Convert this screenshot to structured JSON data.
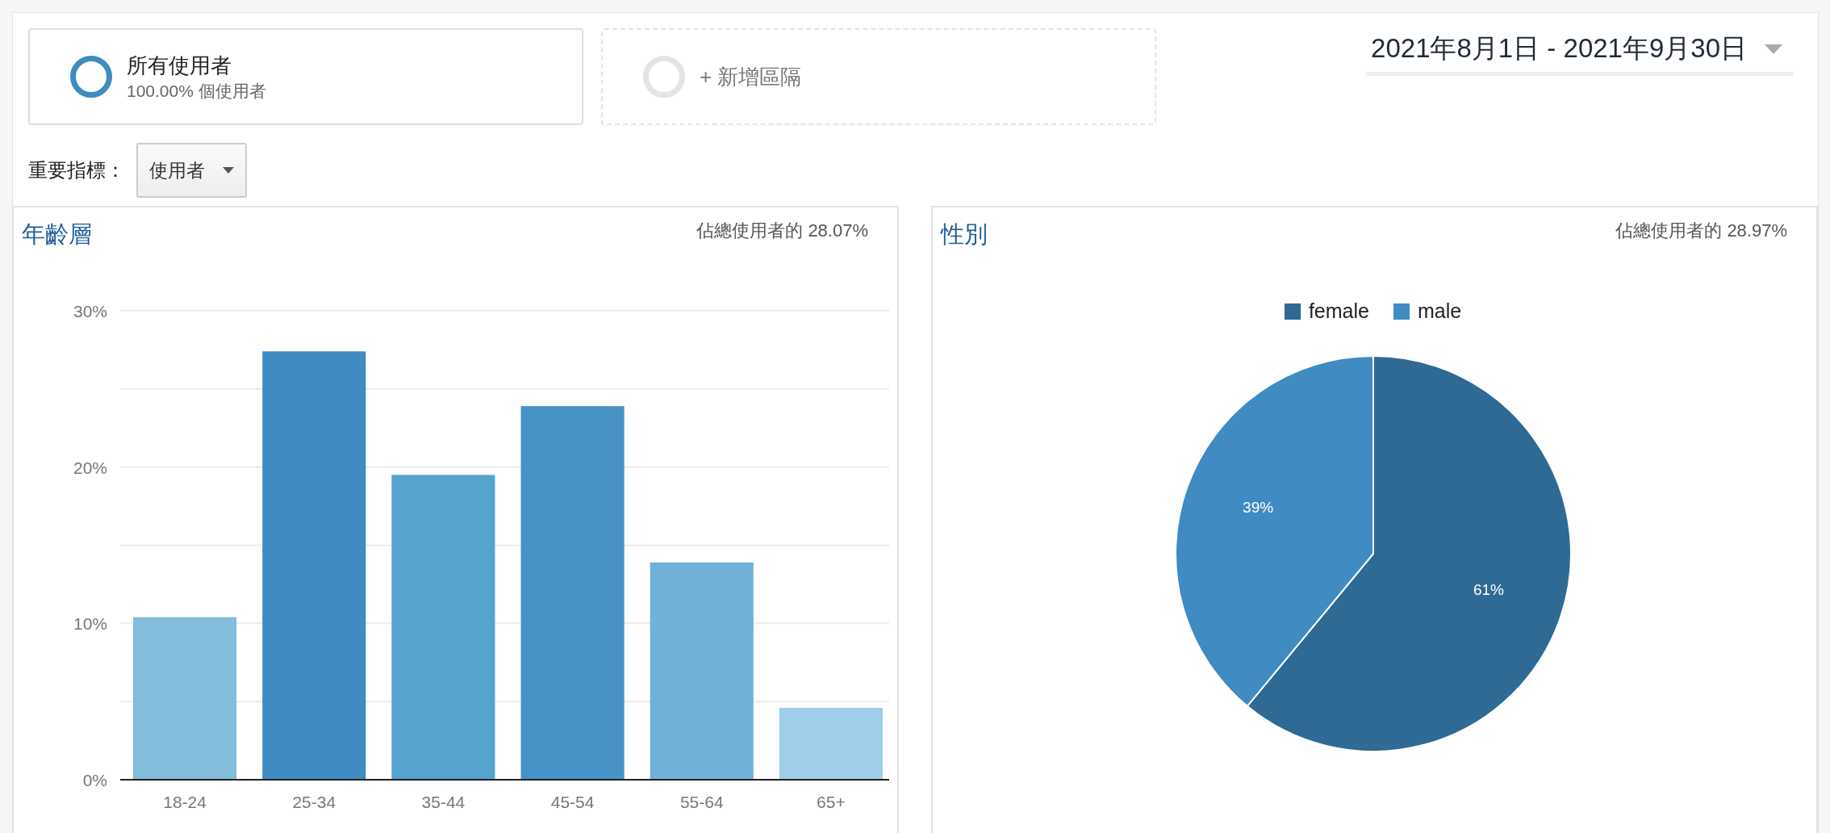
{
  "segments": [
    {
      "kind": "active",
      "title": "所有使用者",
      "subtitle": "100.00% 個使用者"
    },
    {
      "kind": "add",
      "title": "+ 新增區隔"
    }
  ],
  "date_range": {
    "label": "2021年8月1日 - 2021年9月30日"
  },
  "key_metric": {
    "label": "重要指標：",
    "value": "使用者"
  },
  "panels": [
    {
      "title": "年齡層",
      "share": "佔總使用者的 28.07%",
      "chart_data": {
        "type": "bar",
        "categories": [
          "18-24",
          "25-34",
          "35-44",
          "45-54",
          "55-64",
          "65+"
        ],
        "ylim": [
          0,
          30
        ],
        "yticks": [
          {
            "value": 0,
            "label": "0%"
          },
          {
            "value": 10,
            "label": "10%"
          },
          {
            "value": 20,
            "label": "20%"
          },
          {
            "value": 30,
            "label": "30%"
          }
        ],
        "colors": [
          "#82bddb",
          "#3f8bc2",
          "#57a3cf",
          "#4593c6",
          "#70b1d7",
          "#9fcfe8"
        ],
        "series": [
          {
            "values": [
              10.4,
              27.4,
              19.5,
              23.9,
              13.9,
              4.6
            ]
          }
        ]
      }
    },
    {
      "title": "性別",
      "share": "佔總使用者的 28.97%",
      "chart_data": {
        "type": "pie",
        "categories": [
          "female",
          "male"
        ],
        "value_labels": [
          "61%",
          "39%"
        ],
        "series": [
          {
            "values": [
              61,
              39
            ]
          }
        ],
        "colors": [
          "#2e6a94",
          "#3f8bc2"
        ]
      }
    }
  ]
}
